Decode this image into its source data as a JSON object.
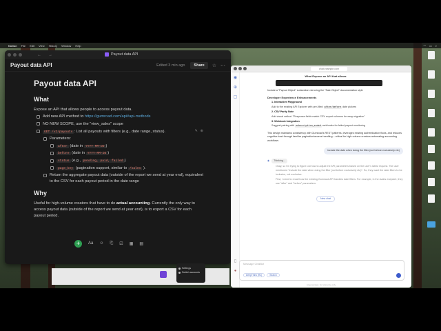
{
  "menubar": {
    "app": "Notion",
    "items": [
      "File",
      "Edit",
      "View",
      "History",
      "Window",
      "Help"
    ],
    "clock": ""
  },
  "notion": {
    "tab_title": "Payout data API",
    "page_name": "Payout data API",
    "edited": "Edited 3 min ago",
    "share": "Share",
    "nav_back": "←",
    "nav_forward": "→",
    "title": "Payout data API",
    "what_heading": "What",
    "what_intro": "Expose an API that allows people to access payout data.",
    "item1_text": "Add new API method to ",
    "item1_link": "https://gumroad.com/api#api-methods",
    "item2": "NO NEW SCOPE, use the \"view_sales\" scope",
    "item3_code": "GET /v2/payouts",
    "item3_text": ": List all payouts with filters (e.g., date range, status).",
    "params_label": "Parameters:",
    "p1_code": "after",
    "p1_text": " (date in ",
    "p1_fmt": "YYYY-MM-DD",
    "p1_end": ")",
    "p2_code": "before",
    "p2_text": " (date in ",
    "p2_fmt": "YYYY-MM-DD",
    "p2_end": ")",
    "p3_code": "status",
    "p3_text": " (e.g., ",
    "p3_vals": "pending, paid, failed",
    "p3_end": ")",
    "p4_code": "page_key",
    "p4_text": " (pagination support, similar to ",
    "p4_ref": "/sales",
    "p4_end": " ).",
    "return_text": "Return the aggregate payout data (outside of the report we send at year end), equivalent to the CSV for each payout period in the date range",
    "why_heading": "Why",
    "why_text_a": "Useful for high-volume creators that have to do ",
    "why_bold": "actual accounting",
    "why_text_b": ". Currently the only way to access payout data (outside of the report we send at year end), is to export a CSV for each payout period.",
    "toolbar": [
      "+",
      "Aa",
      "☺",
      "⎘",
      "☑",
      "▦",
      "▤"
    ]
  },
  "popup": {
    "items": [
      "Settings",
      "Switch accounts"
    ]
  },
  "chat": {
    "url": "chat.example.com",
    "header": "What Expose an API that allows",
    "line1": "Include a \"Payout Object\" subsection mirroring the \"Sale Object\" documentation style",
    "section_title": "Developer Experience Enhancements",
    "li1_title": "1. Interactive Playground",
    "li1_sub_a": "Add to the existing API Explorer with pre-filled ",
    "li1_sub_code": "after/before",
    "li1_sub_b": " date pickers",
    "li2_title": "2. CSV Parity Note",
    "li2_sub": "Add visual callout: \"Response fields match CSV export columns for easy migration\"",
    "li3_title": "3. Webhook Integration",
    "li3_sub_a": "Suggest pairing with ",
    "li3_sub_code": "subscription_ended",
    "li3_sub_b": " webhooks for failed payout monitoring",
    "summary": "This design maintains consistency with Gumroad's REST patterns, leverages existing authentication flows, and reduces cognitive load through familiar pagination/access handling – critical for high-volume creators automating accounting workflows",
    "user_msg": "include the date when doing the filter (not before exclusively etc)",
    "thinking": "Thinking...",
    "gray1": "Okay, so I'm trying to figure out how to adjust the API parameters based on the user's latest request. The user mentioned \"include the date when doing the filter (not before exclusively etc)\". So, they want the date filters to be inclusive, not exclusive.",
    "gray2": "First, I need to recall how the existing Gumroad API handles date filters. For example, in the /sales endpoint, they use \"after\" and \"before\" parameters.",
    "new_chat": "New chat",
    "input_placeholder": "Message ChatBot",
    "tool1": "DeepThink (R1)",
    "tool2": "Search",
    "footer": "AI-generated, for reference only"
  },
  "colors": {
    "accent_green": "#2e9e52",
    "link": "#5aa6d6",
    "code": "#e77b6b",
    "chat_accent": "#3d5ccc"
  }
}
